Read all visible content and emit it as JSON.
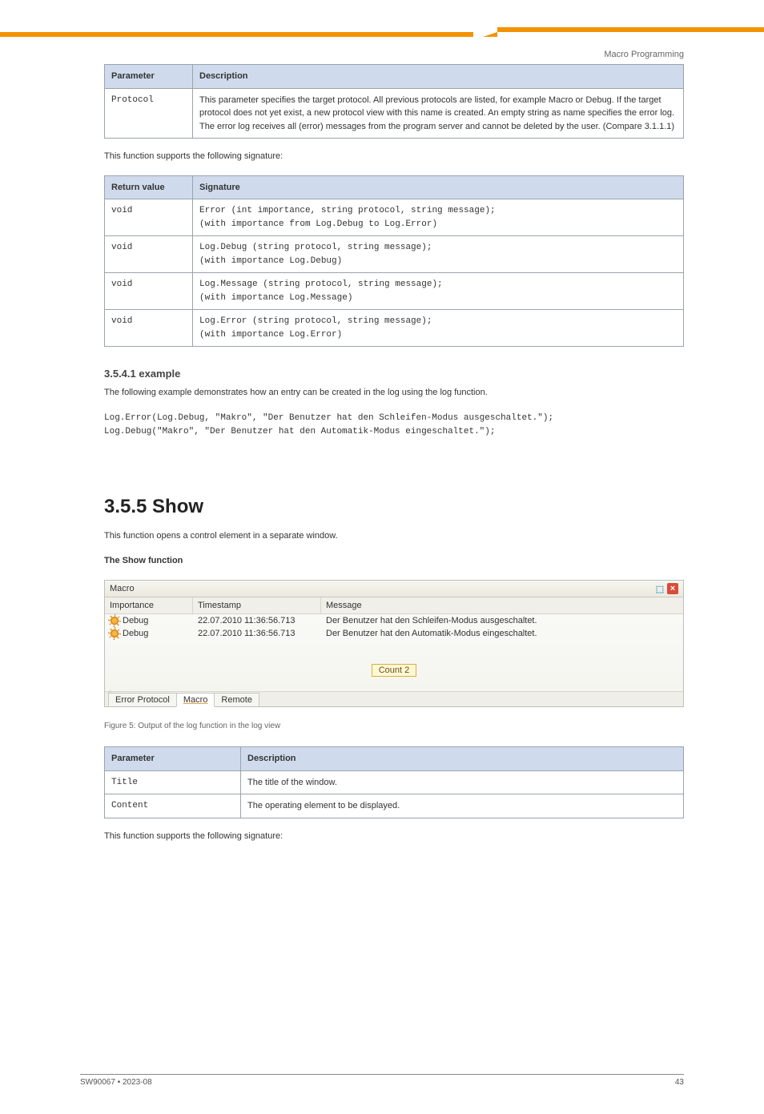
{
  "header": {
    "right": "Macro Programming"
  },
  "table1": {
    "headers": [
      "Parameter",
      "Description"
    ],
    "rows": [
      [
        "Protocol",
        "This parameter specifies the target protocol. All previous protocols are listed, for example Macro or Debug. If the target protocol does not yet exist, a new protocol view with this name is created. An empty string as name specifies the error log. The error log receives all (error) messages from the program server and cannot be deleted by the user. (Compare 3.1.1.1)"
      ]
    ]
  },
  "intro2": "This function supports the following signature:",
  "table2": {
    "headers": [
      "Return value",
      "Signature"
    ],
    "rows": [
      [
        "void",
        "Error (int importance, string protocol, string message);\n(with importance from Log.Debug to Log.Error)"
      ],
      [
        "void",
        "Log.Debug (string protocol, string message);\n(with importance Log.Debug)"
      ],
      [
        "void",
        "Log.Message (string protocol, string message);\n(with importance Log.Message)"
      ],
      [
        "void",
        "Log.Error (string protocol, string message);\n(with importance Log.Error)"
      ]
    ]
  },
  "section_num_title": "3.5.4.1 example",
  "example_intro": "The following example demonstrates how an entry can be created in the log using the log function.",
  "code": "Log.Error(Log.Debug, \"Makro\", \"Der Benutzer hat den Schleifen-Modus ausgeschaltet.\");\nLog.Debug(\"Makro\", \"Der Benutzer hat den Automatik-Modus eingeschaltet.\");",
  "section_major": "3.5.5   Show",
  "show_desc": "This function opens a control element in a separate window.",
  "show_func": "The Show function",
  "macro_panel": {
    "title": "Macro",
    "headers": [
      "Importance",
      "Timestamp",
      "Message"
    ],
    "rows": [
      {
        "icon": "gear",
        "importance": "Debug",
        "timestamp": "22.07.2010 11:36:56.713",
        "message": "Der Benutzer hat den Schleifen-Modus ausgeschaltet."
      },
      {
        "icon": "gear",
        "importance": "Debug",
        "timestamp": "22.07.2010 11:36:56.713",
        "message": "Der Benutzer hat den Automatik-Modus eingeschaltet."
      }
    ],
    "count_label": "Count 2",
    "tabs": [
      "Error Protocol",
      "Macro",
      "Remote"
    ],
    "active_tab": 1
  },
  "fig_caption": "Figure 5: Output of the log function in the log view",
  "table3": {
    "headers": [
      "Parameter",
      "Description"
    ],
    "rows": [
      [
        "Title",
        "The title of the window."
      ],
      [
        "Content",
        "The operating element to be displayed."
      ]
    ]
  },
  "after3": "This function supports the following signature:",
  "footer": {
    "left": "SW90067  •  2023-08",
    "right": "43"
  }
}
